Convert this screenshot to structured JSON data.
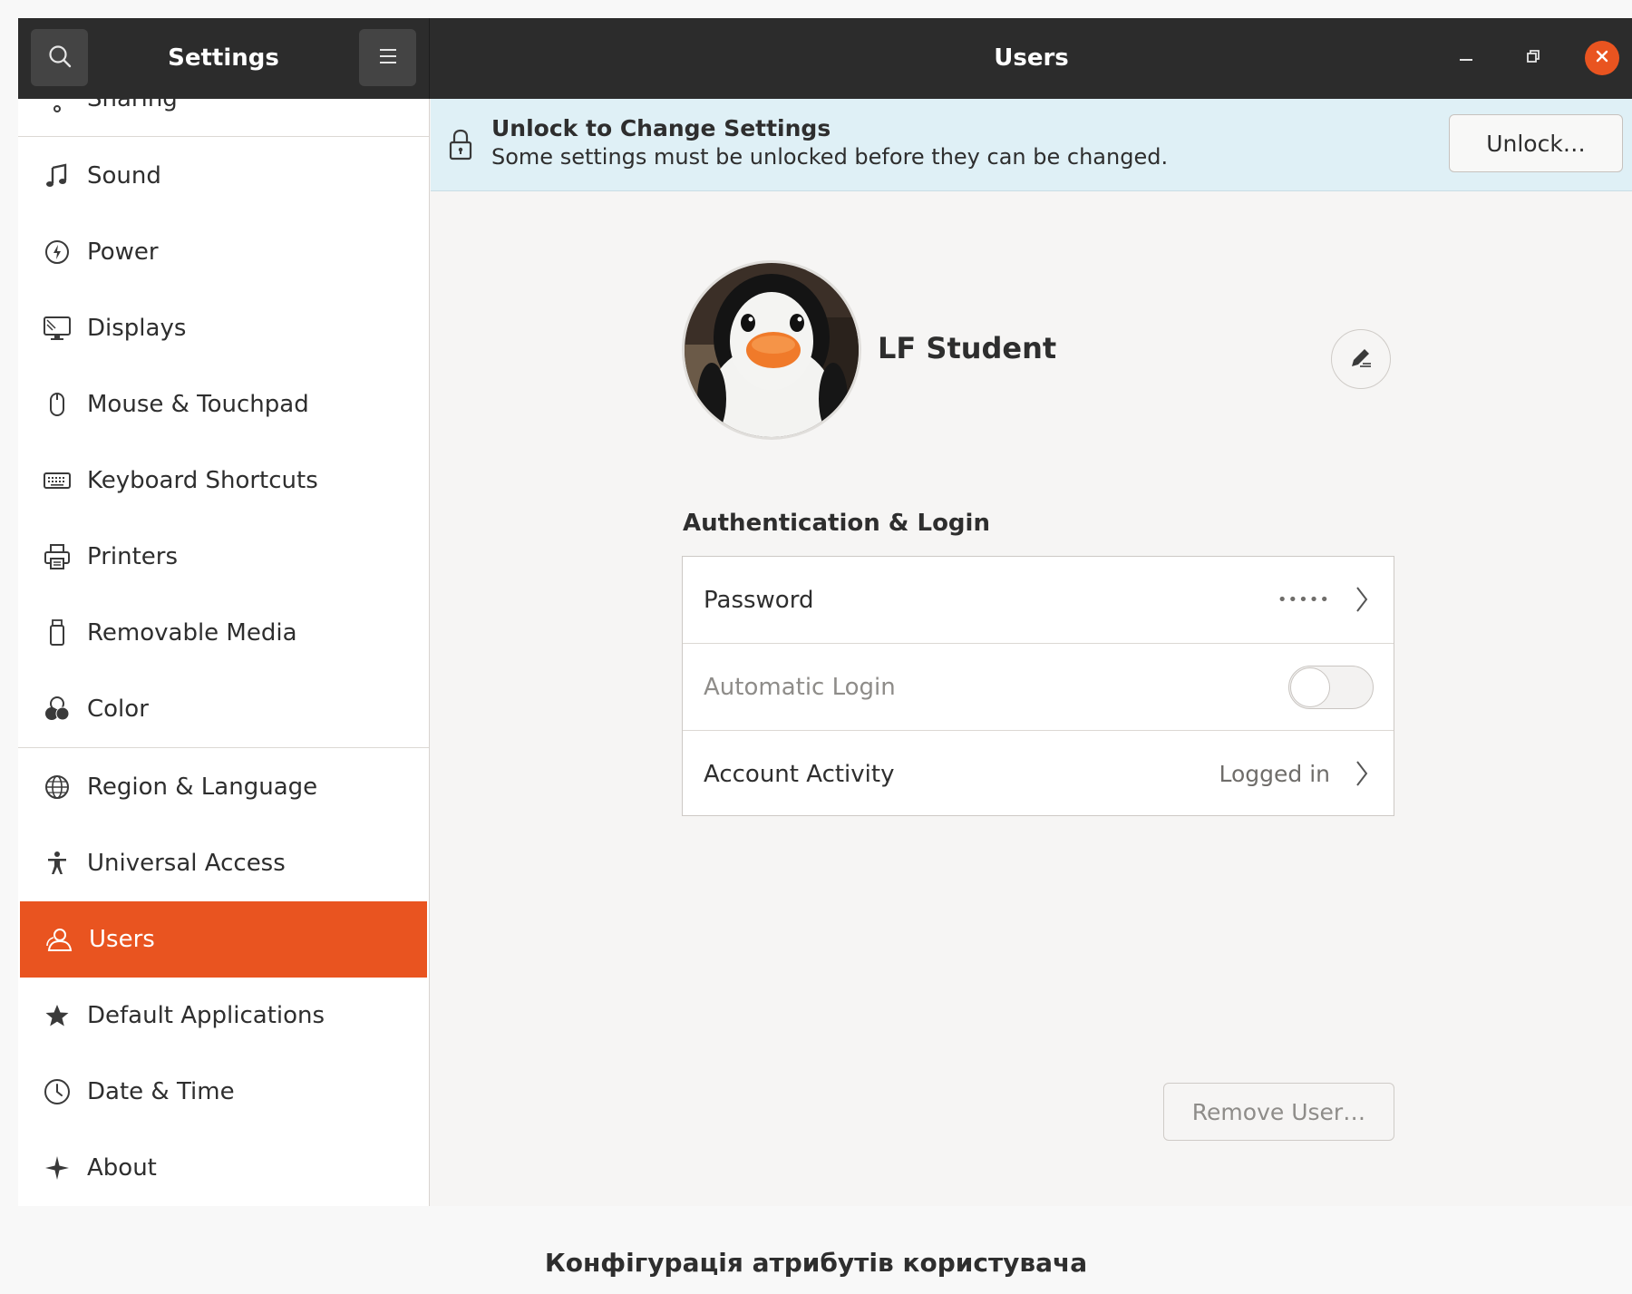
{
  "header": {
    "sidebar_title": "Settings",
    "page_title": "Users",
    "search_icon": "search-icon",
    "menu_icon": "hamburger-icon",
    "window_controls": [
      "minimize-icon",
      "restore-icon",
      "close-icon"
    ]
  },
  "sidebar": {
    "partial_item": "Sharing",
    "items": [
      {
        "label": "Sound",
        "icon": "music-note-icon"
      },
      {
        "label": "Power",
        "icon": "power-icon"
      },
      {
        "label": "Displays",
        "icon": "display-icon"
      },
      {
        "label": "Mouse & Touchpad",
        "icon": "mouse-icon"
      },
      {
        "label": "Keyboard Shortcuts",
        "icon": "keyboard-icon"
      },
      {
        "label": "Printers",
        "icon": "printer-icon"
      },
      {
        "label": "Removable Media",
        "icon": "usb-drive-icon"
      },
      {
        "label": "Color",
        "icon": "color-icon"
      },
      {
        "label": "Region & Language",
        "icon": "globe-icon"
      },
      {
        "label": "Universal Access",
        "icon": "accessibility-icon"
      },
      {
        "label": "Users",
        "icon": "user-icon",
        "active": true
      },
      {
        "label": "Default Applications",
        "icon": "star-icon"
      },
      {
        "label": "Date & Time",
        "icon": "clock-icon"
      },
      {
        "label": "About",
        "icon": "sparkle-icon"
      }
    ]
  },
  "infobar": {
    "title": "Unlock to Change Settings",
    "subtitle": "Some settings must be unlocked before they can be changed.",
    "unlock_label": "Unlock…"
  },
  "user": {
    "name": "LF Student",
    "avatar": "penguin-avatar"
  },
  "auth": {
    "heading": "Authentication & Login",
    "rows": [
      {
        "label": "Password",
        "value": "•••••"
      },
      {
        "label": "Automatic Login",
        "toggle": "off"
      },
      {
        "label": "Account Activity",
        "value": "Logged in"
      }
    ]
  },
  "remove_label": "Remove User…",
  "caption": "Конфігурація атрибутів користувача",
  "colors": {
    "accent": "#e95420",
    "headerbar": "#2c2c2c",
    "infobar": "#dff0f6"
  }
}
